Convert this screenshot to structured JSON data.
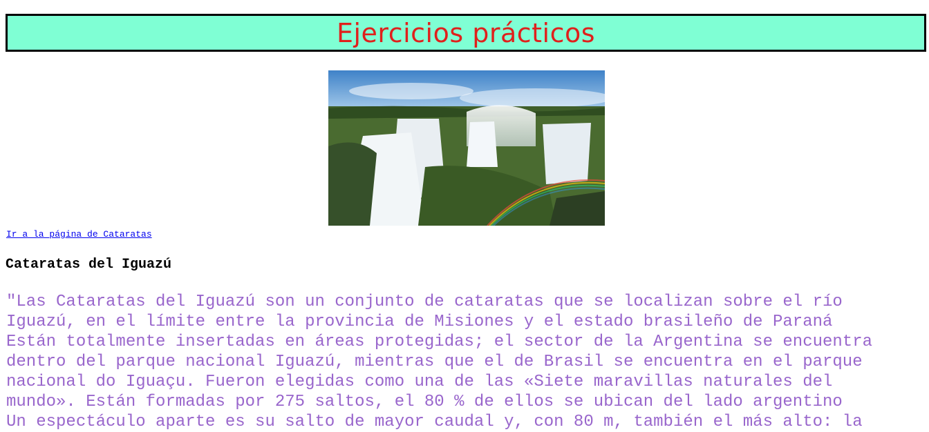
{
  "page": {
    "title": "Ejercicios prácticos",
    "link_text": "Ir a la página de Cataratas",
    "subtitle": "Cataratas del Iguazú",
    "paragraph": "\"Las Cataratas del Iguazú son un conjunto de cataratas que se localizan sobre el río\nIguazú, en el límite entre la provincia de Misiones y el estado brasileño de Paraná\nEstán totalmente insertadas en áreas protegidas; el sector de la Argentina se encuentra\ndentro del parque nacional Iguazú, mientras que el de Brasil se encuentra en el parque\nnacional do Iguaçu. Fueron elegidas como una de las «Siete maravillas naturales del\nmundo». Están formadas por 275 saltos, el 80 % de ellos se ubican del lado argentino\nUn espectáculo aparte es su salto de mayor caudal y, con 80 m, también el más alto: la"
  },
  "colors": {
    "title_bar_bg": "#7fffd4",
    "title_text": "#e0201c",
    "paragraph_text": "#9966cc",
    "link": "#0000ee"
  }
}
